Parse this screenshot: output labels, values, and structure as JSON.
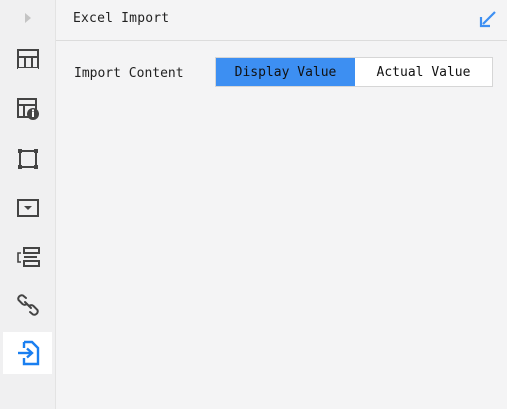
{
  "panel": {
    "title": "Excel Import"
  },
  "import_content": {
    "label": "Import Content",
    "options": [
      "Display Value",
      "Actual Value"
    ],
    "selected": "Display Value"
  },
  "sidebar": {
    "items": [
      {
        "icon": "table-icon"
      },
      {
        "icon": "table-info-icon"
      },
      {
        "icon": "square-frame-icon"
      },
      {
        "icon": "dropdown-box-icon"
      },
      {
        "icon": "field-list-icon"
      },
      {
        "icon": "link-icon"
      },
      {
        "icon": "import-icon",
        "active": true
      }
    ]
  },
  "colors": {
    "accent": "#3d8ff2",
    "icon": "#444444",
    "active_icon": "#1a7ff0",
    "background": "#f4f4f5"
  }
}
